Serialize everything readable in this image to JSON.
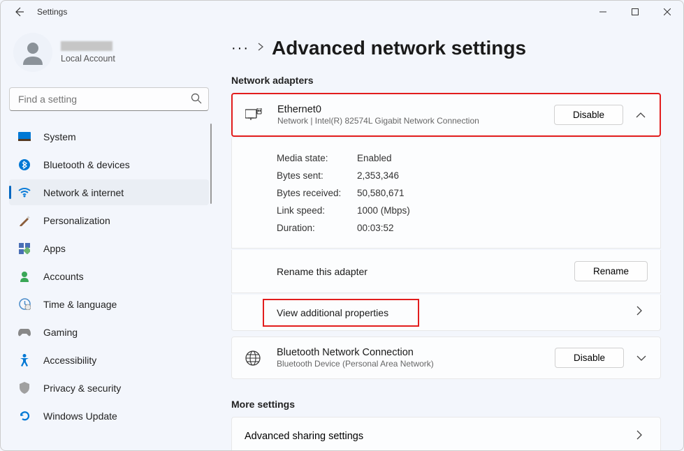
{
  "app": {
    "title": "Settings"
  },
  "user": {
    "type": "Local Account"
  },
  "search": {
    "placeholder": "Find a setting"
  },
  "nav": {
    "system": "System",
    "bluetooth": "Bluetooth & devices",
    "network": "Network & internet",
    "personalization": "Personalization",
    "apps": "Apps",
    "accounts": "Accounts",
    "time": "Time & language",
    "gaming": "Gaming",
    "accessibility": "Accessibility",
    "privacy": "Privacy & security",
    "update": "Windows Update"
  },
  "header": {
    "dots": "···",
    "title": "Advanced network settings"
  },
  "sections": {
    "adapters": "Network adapters",
    "more": "More settings"
  },
  "adapters": {
    "ethernet": {
      "name": "Ethernet0",
      "desc": "Network | Intel(R) 82574L Gigabit Network Connection",
      "disable": "Disable",
      "details": {
        "media_state_label": "Media state:",
        "media_state": "Enabled",
        "bytes_sent_label": "Bytes sent:",
        "bytes_sent": "2,353,346",
        "bytes_received_label": "Bytes received:",
        "bytes_received": "50,580,671",
        "link_speed_label": "Link speed:",
        "link_speed": "1000 (Mbps)",
        "duration_label": "Duration:",
        "duration": "00:03:52"
      },
      "rename_label": "Rename this adapter",
      "rename_btn": "Rename",
      "additional": "View additional properties"
    },
    "bluetooth": {
      "name": "Bluetooth Network Connection",
      "desc": "Bluetooth Device (Personal Area Network)",
      "disable": "Disable"
    }
  },
  "more": {
    "sharing": "Advanced sharing settings"
  }
}
